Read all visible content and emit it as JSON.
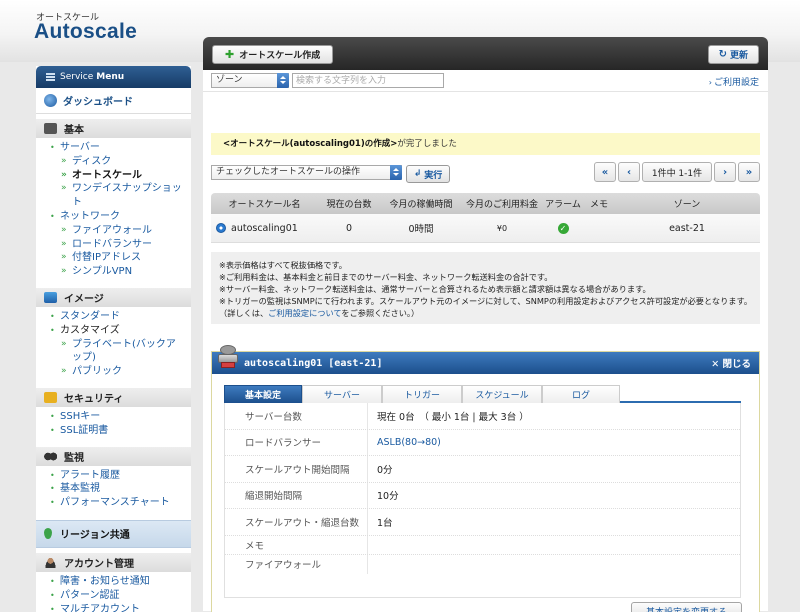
{
  "header": {
    "subtitle": "オートスケール",
    "title": "Autoscale"
  },
  "sidebar": {
    "menu_prefix": "Service",
    "menu_label": "Menu",
    "dashboard": "ダッシュボード",
    "sections": [
      {
        "label": "基本",
        "items": [
          {
            "label": "サーバー",
            "level": 1
          },
          {
            "label": "ディスク",
            "level": 2
          },
          {
            "label": "オートスケール",
            "level": 2,
            "active": true
          },
          {
            "label": "ワンデイスナップショット",
            "level": 2
          },
          {
            "label": "ネットワーク",
            "level": 1
          },
          {
            "label": "ファイアウォール",
            "level": 2
          },
          {
            "label": "ロードバランサー",
            "level": 2
          },
          {
            "label": "付替IPアドレス",
            "level": 2
          },
          {
            "label": "シンプルVPN",
            "level": 2
          }
        ]
      },
      {
        "label": "イメージ",
        "items": [
          {
            "label": "スタンダード",
            "level": 1
          },
          {
            "label": "カスタマイズ",
            "level": 1,
            "dark": true
          },
          {
            "label": "プライベート(バックアップ)",
            "level": 2
          },
          {
            "label": "パブリック",
            "level": 2
          }
        ]
      },
      {
        "label": "セキュリティ",
        "items": [
          {
            "label": "SSHキー",
            "level": 1
          },
          {
            "label": "SSL証明書",
            "level": 1
          }
        ]
      },
      {
        "label": "監視",
        "items": [
          {
            "label": "アラート履歴",
            "level": 1
          },
          {
            "label": "基本監視",
            "level": 1
          },
          {
            "label": "パフォーマンスチャート",
            "level": 1
          }
        ]
      }
    ],
    "region": "リージョン共通",
    "account": {
      "label": "アカウント管理",
      "items": [
        {
          "label": "障害・お知らせ通知",
          "level": 1
        },
        {
          "label": "パターン認証",
          "level": 1
        },
        {
          "label": "マルチアカウント",
          "level": 1
        }
      ]
    }
  },
  "toolbar": {
    "create_label": "オートスケール作成",
    "refresh_label": "更新"
  },
  "filter": {
    "zone_value": "ゾーン",
    "search_placeholder": "検索する文字列を入力",
    "help_label": "ご利用設定"
  },
  "notice": {
    "name": "<オートスケール(autoscaling01)の作成>",
    "suffix": "が完了しました"
  },
  "actions": {
    "select_value": "チェックしたオートスケールの操作",
    "exec_label": "実行"
  },
  "pager": {
    "first": "«",
    "prev": "‹",
    "info": "1件中 1-1件",
    "next": "›",
    "last": "»"
  },
  "table": {
    "headers": [
      "オートスケール名",
      "現在の台数",
      "今月の稼働時間",
      "今月のご利用料金",
      "アラーム",
      "メモ",
      "ゾーン"
    ],
    "rows": [
      {
        "name": "autoscaling01",
        "count": "0",
        "hours": "0時間",
        "fee": "¥0",
        "memo": "",
        "zone": "east-21"
      }
    ]
  },
  "notes": {
    "lines": [
      "※表示価格はすべて税抜価格です。",
      "※ご利用料金は、基本料金と前日までのサーバー料金、ネットワーク転送料金の合計です。",
      "※サーバー料金、ネットワーク転送料金は、通常サーバーと合算されるため表示額と請求額は異なる場合があります。",
      "※トリガーの監視はSNMPにて行われます。スケールアウト元のイメージに対して、SNMPの利用設定およびアクセス許可設定が必要となります。（詳しくは、"
    ],
    "link": "ご利用設定について",
    "tail": "をご参照ください。）"
  },
  "detail": {
    "title": "autoscaling01 [east-21]",
    "close_label": "閉じる",
    "tabs": [
      "基本設定",
      "サーバー",
      "トリガー",
      "スケジュール",
      "ログ"
    ],
    "props": [
      {
        "key": "サーバー台数",
        "value": "現在 0台　（ 最小 1台 | 最大 3台 ）"
      },
      {
        "key": "ロードバランサー",
        "value": "ASLB(80→80)",
        "link": true
      },
      {
        "key": "スケールアウト開始間隔",
        "value": "0分"
      },
      {
        "key": "縮退開始間隔",
        "value": "10分"
      },
      {
        "key": "スケールアウト・縮退台数",
        "value": "1台"
      },
      {
        "key": "メモ",
        "value": ""
      },
      {
        "key": "ファイアウォール",
        "value": ""
      }
    ],
    "edit_label": "基本設定を変更する"
  }
}
